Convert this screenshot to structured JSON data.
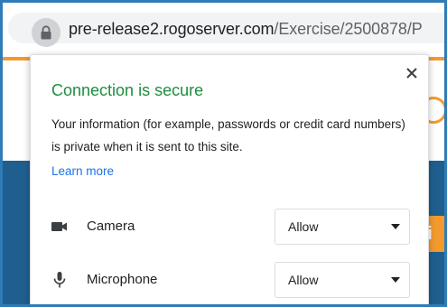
{
  "address_bar": {
    "host": "pre-release2.rogoserver.com",
    "path": "/Exercise/2500878/P"
  },
  "background_page": {
    "button_fragment": "gi"
  },
  "popup": {
    "title": "Connection is secure",
    "description": "Your information (for example, passwords or credit card numbers) is private when it is sent to this site.",
    "learn_more": "Learn more",
    "permissions": [
      {
        "icon": "camera-icon",
        "label": "Camera",
        "value": "Allow"
      },
      {
        "icon": "microphone-icon",
        "label": "Microphone",
        "value": "Allow"
      }
    ]
  },
  "colors": {
    "secure_green": "#1e8e3e",
    "link_blue": "#1a73e8",
    "site_orange": "#f39a2e",
    "site_blue": "#1f5f8f"
  }
}
